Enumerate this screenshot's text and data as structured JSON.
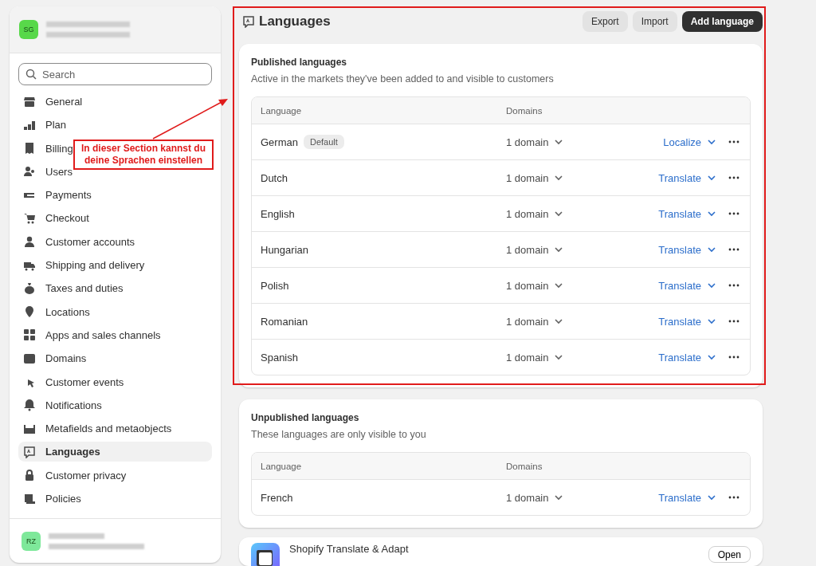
{
  "sidebar": {
    "store": {
      "initials": "SG"
    },
    "search": {
      "placeholder": "Search"
    },
    "items": [
      {
        "label": "General",
        "selected": false
      },
      {
        "label": "Plan",
        "selected": false
      },
      {
        "label": "Billing",
        "selected": false
      },
      {
        "label": "Users",
        "selected": false
      },
      {
        "label": "Payments",
        "selected": false
      },
      {
        "label": "Checkout",
        "selected": false
      },
      {
        "label": "Customer accounts",
        "selected": false
      },
      {
        "label": "Shipping and delivery",
        "selected": false
      },
      {
        "label": "Taxes and duties",
        "selected": false
      },
      {
        "label": "Locations",
        "selected": false
      },
      {
        "label": "Apps and sales channels",
        "selected": false
      },
      {
        "label": "Domains",
        "selected": false
      },
      {
        "label": "Customer events",
        "selected": false
      },
      {
        "label": "Notifications",
        "selected": false
      },
      {
        "label": "Metafields and metaobjects",
        "selected": false
      },
      {
        "label": "Languages",
        "selected": true
      },
      {
        "label": "Customer privacy",
        "selected": false
      },
      {
        "label": "Policies",
        "selected": false
      }
    ],
    "user": {
      "initials": "RZ"
    }
  },
  "page": {
    "title": "Languages",
    "actions": [
      {
        "label": "Export",
        "kind": "secondary"
      },
      {
        "label": "Import",
        "kind": "secondary"
      },
      {
        "label": "Add language",
        "kind": "primary"
      }
    ]
  },
  "sections": [
    {
      "title": "Published languages",
      "subtitle": "Active in the markets they've been added to and visible to customers",
      "columns": [
        "Language",
        "Domains"
      ],
      "rows": [
        {
          "language": "German",
          "badge": "Default",
          "domains": "1 domain",
          "action": "Localize"
        },
        {
          "language": "Dutch",
          "domains": "1 domain",
          "action": "Translate"
        },
        {
          "language": "English",
          "domains": "1 domain",
          "action": "Translate"
        },
        {
          "language": "Hungarian",
          "domains": "1 domain",
          "action": "Translate"
        },
        {
          "language": "Polish",
          "domains": "1 domain",
          "action": "Translate"
        },
        {
          "language": "Romanian",
          "domains": "1 domain",
          "action": "Translate"
        },
        {
          "language": "Spanish",
          "domains": "1 domain",
          "action": "Translate"
        }
      ]
    },
    {
      "title": "Unpublished languages",
      "subtitle": "These languages are only visible to you",
      "columns": [
        "Language",
        "Domains"
      ],
      "rows": [
        {
          "language": "French",
          "domains": "1 domain",
          "action": "Translate"
        }
      ]
    }
  ],
  "app_card": {
    "name": "Shopify Translate & Adapt",
    "button": "Open"
  },
  "annotation": {
    "text": "In dieser Section kannst du deine Sprachen einstellen"
  }
}
